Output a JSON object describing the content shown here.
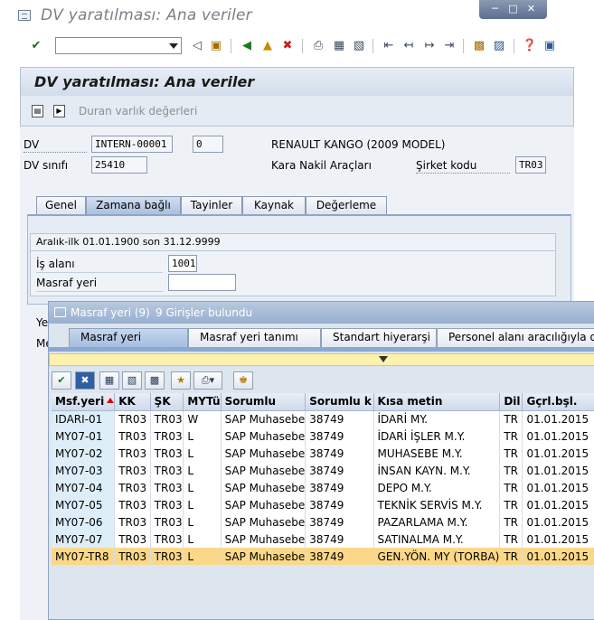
{
  "window": {
    "title": "DV yaratılması: Ana veriler"
  },
  "toolbar": {
    "command_field_value": ""
  },
  "screen": {
    "title": "DV yaratılması: Ana veriler",
    "app_button_label": "Duran varlık değerleri"
  },
  "header": {
    "dv_label": "DV",
    "dv_value": "INTERN-00001",
    "dv_sub": "0",
    "dv_desc": "RENAULT KANGO (2009 MODEL)",
    "class_label": "DV sınıfı",
    "class_value": "25410",
    "class_desc": "Kara Nakil Araçları",
    "company_label": "Şirket kodu",
    "company_value": "TR03"
  },
  "tabs": [
    {
      "label": "Genel"
    },
    {
      "label": "Zamana bağlı"
    },
    {
      "label": "Tayinler"
    },
    {
      "label": "Kaynak"
    },
    {
      "label": "Değerleme"
    }
  ],
  "timeblock": {
    "range_text": "Aralık-ilk 01.01.1900 son 31.12.9999",
    "business_area_label": "İş alanı",
    "business_area_value": "1001",
    "cost_center_label": "Masraf yeri",
    "cost_center_value": "",
    "hidden_label_1": "Ye",
    "hidden_label_2": "Me"
  },
  "popup": {
    "title": "Masraf yeri (9)",
    "count_text": "9 Girişler bulundu",
    "tabs": [
      {
        "label": "Masraf yeri"
      },
      {
        "label": "Masraf yeri tanımı"
      },
      {
        "label": "Standart hiyerarşi"
      },
      {
        "label": "Personel alanı aracılığıyla organi"
      }
    ],
    "columns": [
      "Msf.yeri",
      "KK",
      "ŞK",
      "MYTü",
      "Sorumlu",
      "Sorumlu k",
      "Kısa metin",
      "Dil",
      "Gçrl.bşl."
    ],
    "rows": [
      [
        "IDARI-01",
        "TR03",
        "TR03",
        "W",
        "SAP Muhasebe",
        "38749",
        "İDARİ MY.",
        "TR",
        "01.01.2015"
      ],
      [
        "MY07-01",
        "TR03",
        "TR03",
        "L",
        "SAP Muhasebe",
        "38749",
        "İDARİ İŞLER M.Y.",
        "TR",
        "01.01.2015"
      ],
      [
        "MY07-02",
        "TR03",
        "TR03",
        "L",
        "SAP Muhasebe",
        "38749",
        "MUHASEBE M.Y.",
        "TR",
        "01.01.2015"
      ],
      [
        "MY07-03",
        "TR03",
        "TR03",
        "L",
        "SAP Muhasebe",
        "38749",
        "İNSAN KAYN. M.Y.",
        "TR",
        "01.01.2015"
      ],
      [
        "MY07-04",
        "TR03",
        "TR03",
        "L",
        "SAP Muhasebe",
        "38749",
        "DEPO M.Y.",
        "TR",
        "01.01.2015"
      ],
      [
        "MY07-05",
        "TR03",
        "TR03",
        "L",
        "SAP Muhasebe",
        "38749",
        "TEKNİK SERVİS M.Y.",
        "TR",
        "01.01.2015"
      ],
      [
        "MY07-06",
        "TR03",
        "TR03",
        "L",
        "SAP Muhasebe",
        "38749",
        "PAZARLAMA M.Y.",
        "TR",
        "01.01.2015"
      ],
      [
        "MY07-07",
        "TR03",
        "TR03",
        "L",
        "SAP Muhasebe",
        "38749",
        "SATINALMA M.Y.",
        "TR",
        "01.01.2015"
      ],
      [
        "MY07-TR8",
        "TR03",
        "TR03",
        "L",
        "SAP Muhasebe",
        "38749",
        "GEN.YÖN. MY (TORBA)",
        "TR",
        "01.01.2015"
      ]
    ],
    "selected_row_index": 8
  },
  "colors": {
    "selected_row": "#fbd888",
    "key_column": "#ddeef8",
    "header_blue": "#97afcf",
    "collapser_yellow": "#fff2ad"
  }
}
